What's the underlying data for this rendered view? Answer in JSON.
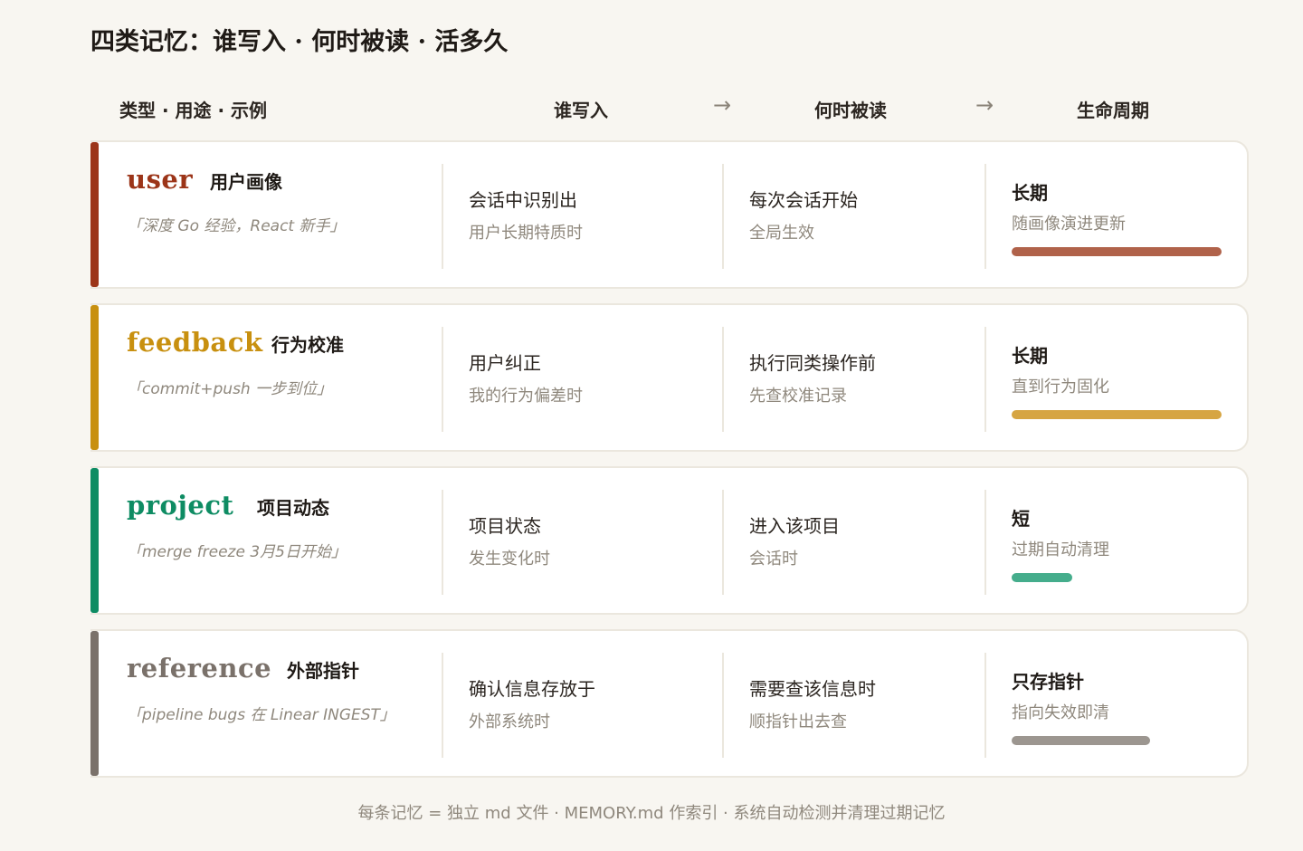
{
  "title": "四类记忆：谁写入 · 何时被读 · 活多久",
  "header": {
    "type_col": "类型 · 用途 · 示例",
    "write_col": "谁写入",
    "read_col": "何时被读",
    "life_col": "生命周期",
    "arrow": "→"
  },
  "rows": [
    {
      "type": "user",
      "purpose": "用户画像",
      "example": "「深度 Go 经验，React 新手」",
      "write_main": "会话中识别出",
      "write_sub": "用户长期特质时",
      "read_main": "每次会话开始",
      "read_sub": "全局生效",
      "life_main": "长期",
      "life_sub": "随画像演进更新",
      "life_fraction": 1.0,
      "accent": "#9c3519",
      "bar": "#b0624a"
    },
    {
      "type": "feedback",
      "purpose": "行为校准",
      "example": "「commit+push 一步到位」",
      "write_main": "用户纠正",
      "write_sub": "我的行为偏差时",
      "read_main": "执行同类操作前",
      "read_sub": "先查校准记录",
      "life_main": "长期",
      "life_sub": "直到行为固化",
      "life_fraction": 1.0,
      "accent": "#c8900f",
      "bar": "#d6a542"
    },
    {
      "type": "project",
      "purpose": "项目动态",
      "example": "「merge freeze 3月5日开始」",
      "write_main": "项目状态",
      "write_sub": "发生变化时",
      "read_main": "进入该项目",
      "read_sub": "会话时",
      "life_main": "短",
      "life_sub": "过期自动清理",
      "life_fraction": 0.29,
      "accent": "#0e8c63",
      "bar": "#45ad8c"
    },
    {
      "type": "reference",
      "purpose": "外部指针",
      "example": "「pipeline bugs 在 Linear INGEST」",
      "write_main": "确认信息存放于",
      "write_sub": "外部系统时",
      "read_main": "需要查该信息时",
      "read_sub": "顺指针出去查",
      "life_main": "只存指针",
      "life_sub": "指向失效即清",
      "life_fraction": 0.66,
      "accent": "#7a716a",
      "bar": "#9c9690"
    }
  ],
  "footer": "每条记忆 = 独立 md 文件 · MEMORY.md 作索引 · 系统自动检测并清理过期记忆"
}
